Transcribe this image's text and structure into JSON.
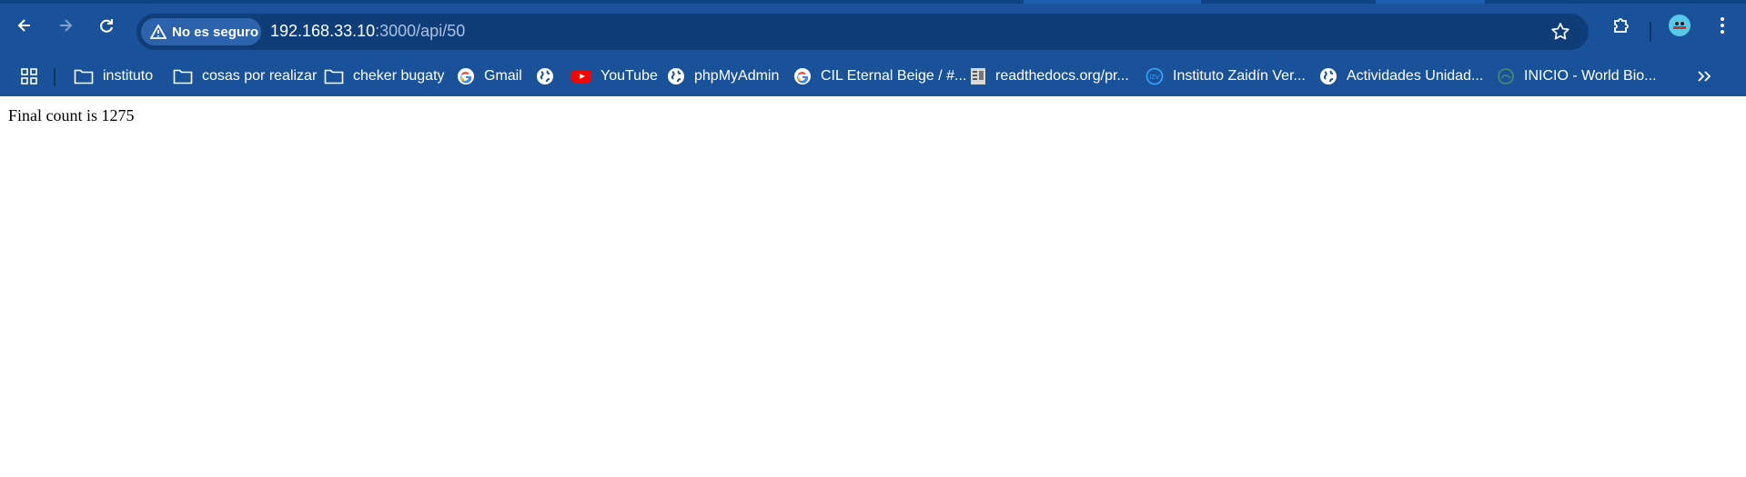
{
  "address_bar": {
    "security_label": "No es seguro",
    "url_host": "192.168.33.10",
    "url_path": ":3000/api/50"
  },
  "bookmarks": [
    {
      "label": "instituto",
      "icon": "folder-icon"
    },
    {
      "label": "cosas por realizar",
      "icon": "folder-icon"
    },
    {
      "label": "cheker bugaty",
      "icon": "folder-icon"
    },
    {
      "label": "Gmail",
      "icon": "google-icon"
    },
    {
      "label": "",
      "icon": "globe-icon"
    },
    {
      "label": "YouTube",
      "icon": "youtube-icon"
    },
    {
      "label": "phpMyAdmin",
      "icon": "globe-icon"
    },
    {
      "label": "CIL Eternal Beige / #...",
      "icon": "google-icon"
    },
    {
      "label": "readthedocs.org/pr...",
      "icon": "docs-icon"
    },
    {
      "label": "Instituto Zaidín Ver...",
      "icon": "school-icon"
    },
    {
      "label": "Actividades Unidad...",
      "icon": "globe-icon"
    },
    {
      "label": "INICIO - World Bio...",
      "icon": "site-icon"
    }
  ],
  "page": {
    "text": "Final count is 1275"
  },
  "colors": {
    "toolbar_bg": "#1a5299",
    "omnibox_bg": "#0f3d78",
    "security_chip_bg": "#2d63ad",
    "url_path": "#a9c1e4"
  }
}
